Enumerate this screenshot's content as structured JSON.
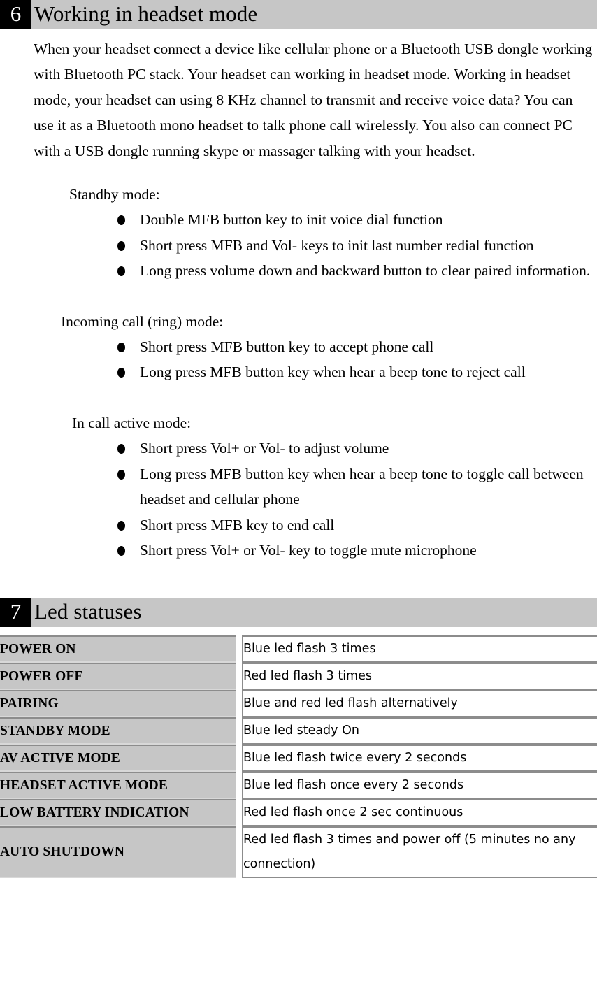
{
  "colors": {
    "heading_bar_bg": "#c6c6c6",
    "heading_num_bg": "#000000",
    "heading_num_fg": "#ffffff",
    "table_key_bg": "#c6c6c6",
    "table_border": "#8c8c8c",
    "text": "#000000"
  },
  "section6": {
    "number": "6",
    "title": "Working in headset mode",
    "paragraph": "When your headset connect a device like cellular phone or a Bluetooth USB dongle working with Bluetooth PC stack. Your headset can working in headset mode. Working in headset mode, your headset can using 8 KHz channel to transmit and receive voice data? You can use it as a Bluetooth mono headset to talk phone call wirelessly. You also can connect PC with a USB dongle running skype or massager talking with your headset.",
    "modes": [
      {
        "label": "Standby mode:",
        "bullets": [
          "Double MFB button key to init voice dial function",
          "Short press MFB and Vol- keys to init last number redial function",
          "Long press volume down and backward button to clear paired information."
        ]
      },
      {
        "label": "Incoming call (ring) mode:",
        "bullets": [
          "Short press MFB button key to accept phone call",
          "Long press MFB button key when hear a beep tone to reject call"
        ]
      },
      {
        "label": "In call active mode:",
        "bullets": [
          "Short press Vol+ or Vol- to adjust volume",
          "Long press MFB button key when hear a beep tone to toggle call between headset and cellular phone",
          "Short press MFB key to end call",
          "Short press Vol+ or Vol- key to toggle mute microphone"
        ]
      }
    ]
  },
  "section7": {
    "number": "7",
    "title": "Led statuses",
    "table": {
      "rows": [
        {
          "key": "POWER ON",
          "value": "Blue led flash 3 times"
        },
        {
          "key": "POWER OFF",
          "value": "Red led flash 3 times"
        },
        {
          "key": "PAIRING",
          "value": "Blue and red led flash alternatively"
        },
        {
          "key": "STANDBY MODE",
          "value": "Blue led steady On"
        },
        {
          "key": "AV ACTIVE MODE",
          "value": "Blue led flash twice every 2 seconds"
        },
        {
          "key": "HEADSET ACTIVE MODE",
          "value": "Blue led flash once every 2 seconds"
        },
        {
          "key": "LOW BATTERY INDICATION",
          "value": "Red led flash once 2 sec continuous"
        },
        {
          "key": "AUTO SHUTDOWN",
          "value": "Red led flash 3 times and power off (5 minutes no any connection)"
        }
      ]
    }
  }
}
